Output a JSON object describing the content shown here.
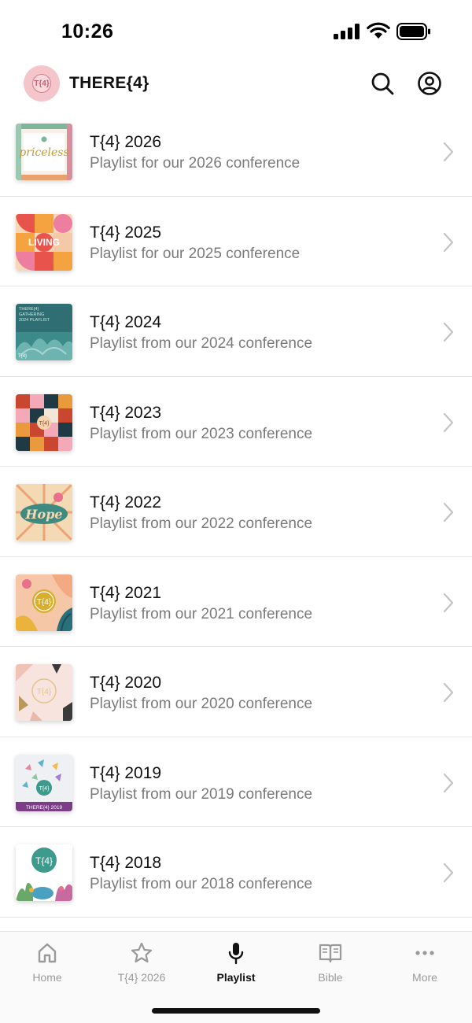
{
  "status_bar": {
    "time": "10:26"
  },
  "header": {
    "title": "THERE{4}",
    "logo_text": "T{4}"
  },
  "playlists": [
    {
      "title": "T{4} 2026",
      "subtitle": "Playlist for our 2026 conference",
      "thumb_text": "priceless"
    },
    {
      "title": "T{4} 2025",
      "subtitle": "Playlist for our 2025 conference",
      "thumb_text": "LIVING"
    },
    {
      "title": "T{4} 2024",
      "subtitle": "Playlist from our 2024 conference",
      "thumb_text": "THERE{4} GATHERING 2024 PLAYLIST"
    },
    {
      "title": "T{4} 2023",
      "subtitle": "Playlist from our 2023 conference",
      "thumb_text": "T{4}"
    },
    {
      "title": "T{4} 2022",
      "subtitle": "Playlist from our 2022 conference",
      "thumb_text": "Hope"
    },
    {
      "title": "T{4} 2021",
      "subtitle": "Playlist from our 2021 conference",
      "thumb_text": "T{4}"
    },
    {
      "title": "T{4} 2020",
      "subtitle": "Playlist from our 2020 conference",
      "thumb_text": "T{4}"
    },
    {
      "title": "T{4} 2019",
      "subtitle": "Playlist from our 2019 conference",
      "thumb_text": "THERE{4} 2019"
    },
    {
      "title": "T{4} 2018",
      "subtitle": "Playlist from our 2018 conference",
      "thumb_text": "T{4}"
    }
  ],
  "tab_bar": {
    "tabs": [
      {
        "label": "Home",
        "icon": "home-icon"
      },
      {
        "label": "T{4} 2026",
        "icon": "star-icon"
      },
      {
        "label": "Playlist",
        "icon": "microphone-icon",
        "active": true
      },
      {
        "label": "Bible",
        "icon": "book-icon"
      },
      {
        "label": "More",
        "icon": "more-icon"
      }
    ]
  },
  "colors": {
    "accent": "#111111",
    "inactive": "#9a9a9a",
    "logo_bg": "#f4c6cb"
  }
}
